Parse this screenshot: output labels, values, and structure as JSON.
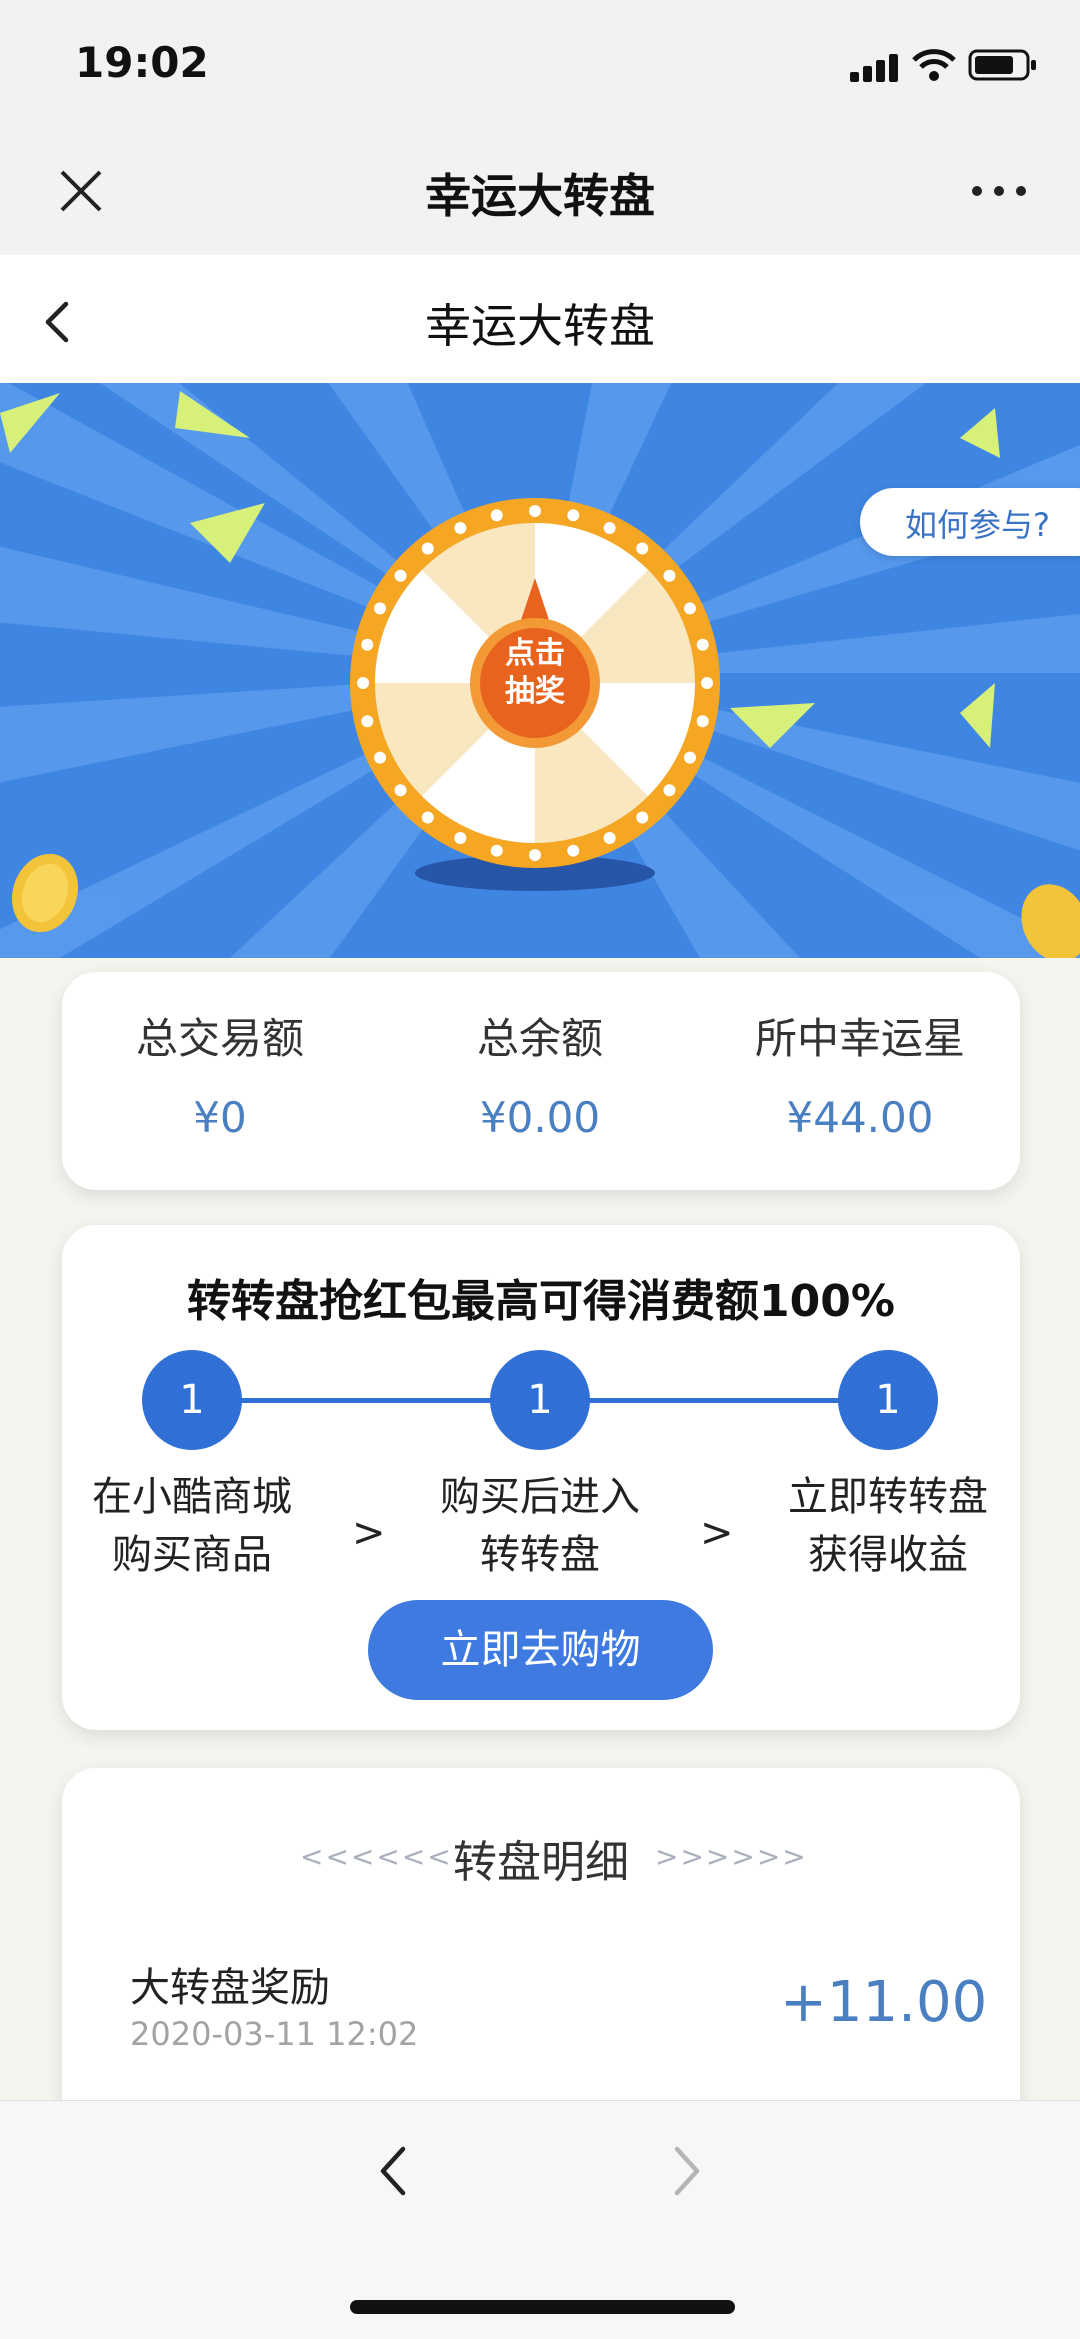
{
  "status_bar": {
    "time": "19:02"
  },
  "wechat_header": {
    "title": "幸运大转盘"
  },
  "page_header": {
    "title": "幸运大转盘"
  },
  "banner": {
    "how_to_join": "如何参与?",
    "wheel_button": [
      "点击",
      "抽奖"
    ]
  },
  "stats": [
    {
      "label": "总交易额",
      "value": "¥0"
    },
    {
      "label": "总余额",
      "value": "¥0.00"
    },
    {
      "label": "所中幸运星",
      "value": "¥44.00"
    }
  ],
  "steps_card": {
    "heading": "转转盘抢红包最高可得消费额100%",
    "steps": [
      {
        "number": "1",
        "line1": "在小酷商城",
        "line2": "购买商品"
      },
      {
        "number": "1",
        "line1": "购买后进入",
        "line2": "转转盘"
      },
      {
        "number": "1",
        "line1": "立即转转盘",
        "line2": "获得收益"
      }
    ],
    "arrow": ">",
    "button": "立即去购物"
  },
  "details": {
    "title": "转盘明细",
    "left_deco": "<<<<<<",
    "right_deco": ">>>>>>",
    "records": [
      {
        "name": "大转盘奖励",
        "time": "2020-03-11 12:02",
        "amount": "+11.00"
      }
    ]
  },
  "colors": {
    "accent": "#3e7ae0",
    "banner_blue": "#3a82e0",
    "value_blue": "#4a7fc1",
    "wheel_orange": "#f5a623"
  }
}
